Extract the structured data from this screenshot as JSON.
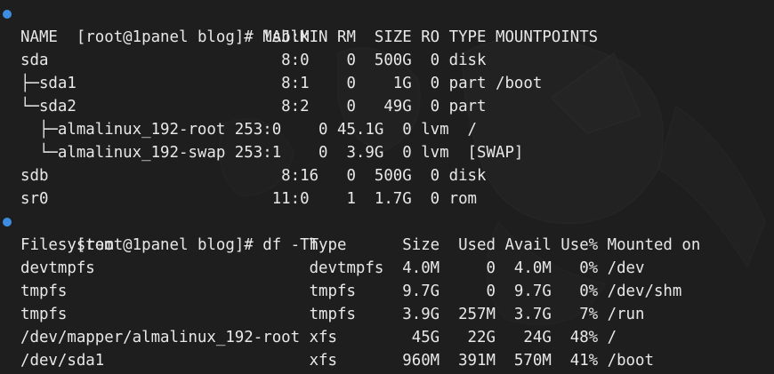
{
  "colors": {
    "background": "#1e1e1e",
    "text": "#e8e8e8",
    "command_marker": "#3d8ee3"
  },
  "blocks": [
    {
      "command": "[root@1panel blog]# lsblk",
      "output": [
        "NAME                      MAJ:MIN RM  SIZE RO TYPE MOUNTPOINTS",
        "sda                         8:0    0  500G  0 disk",
        "├─sda1                      8:1    0    1G  0 part /boot",
        "└─sda2                      8:2    0   49G  0 part",
        "  ├─almalinux_192-root 253:0    0 45.1G  0 lvm  /",
        "  └─almalinux_192-swap 253:1    0  3.9G  0 lvm  [SWAP]",
        "sdb                         8:16   0  500G  0 disk",
        "sr0                        11:0    1  1.7G  0 rom"
      ]
    },
    {
      "command": "[root@1panel blog]# df -Th",
      "output": [
        "Filesystem                     Type      Size  Used Avail Use% Mounted on",
        "devtmpfs                       devtmpfs  4.0M     0  4.0M   0% /dev",
        "tmpfs                          tmpfs     9.7G     0  9.7G   0% /dev/shm",
        "tmpfs                          tmpfs     3.9G  257M  3.7G   7% /run",
        "/dev/mapper/almalinux_192-root xfs        45G   22G   24G  48% /",
        "/dev/sda1                      xfs       960M  391M  570M  41% /boot"
      ]
    }
  ]
}
